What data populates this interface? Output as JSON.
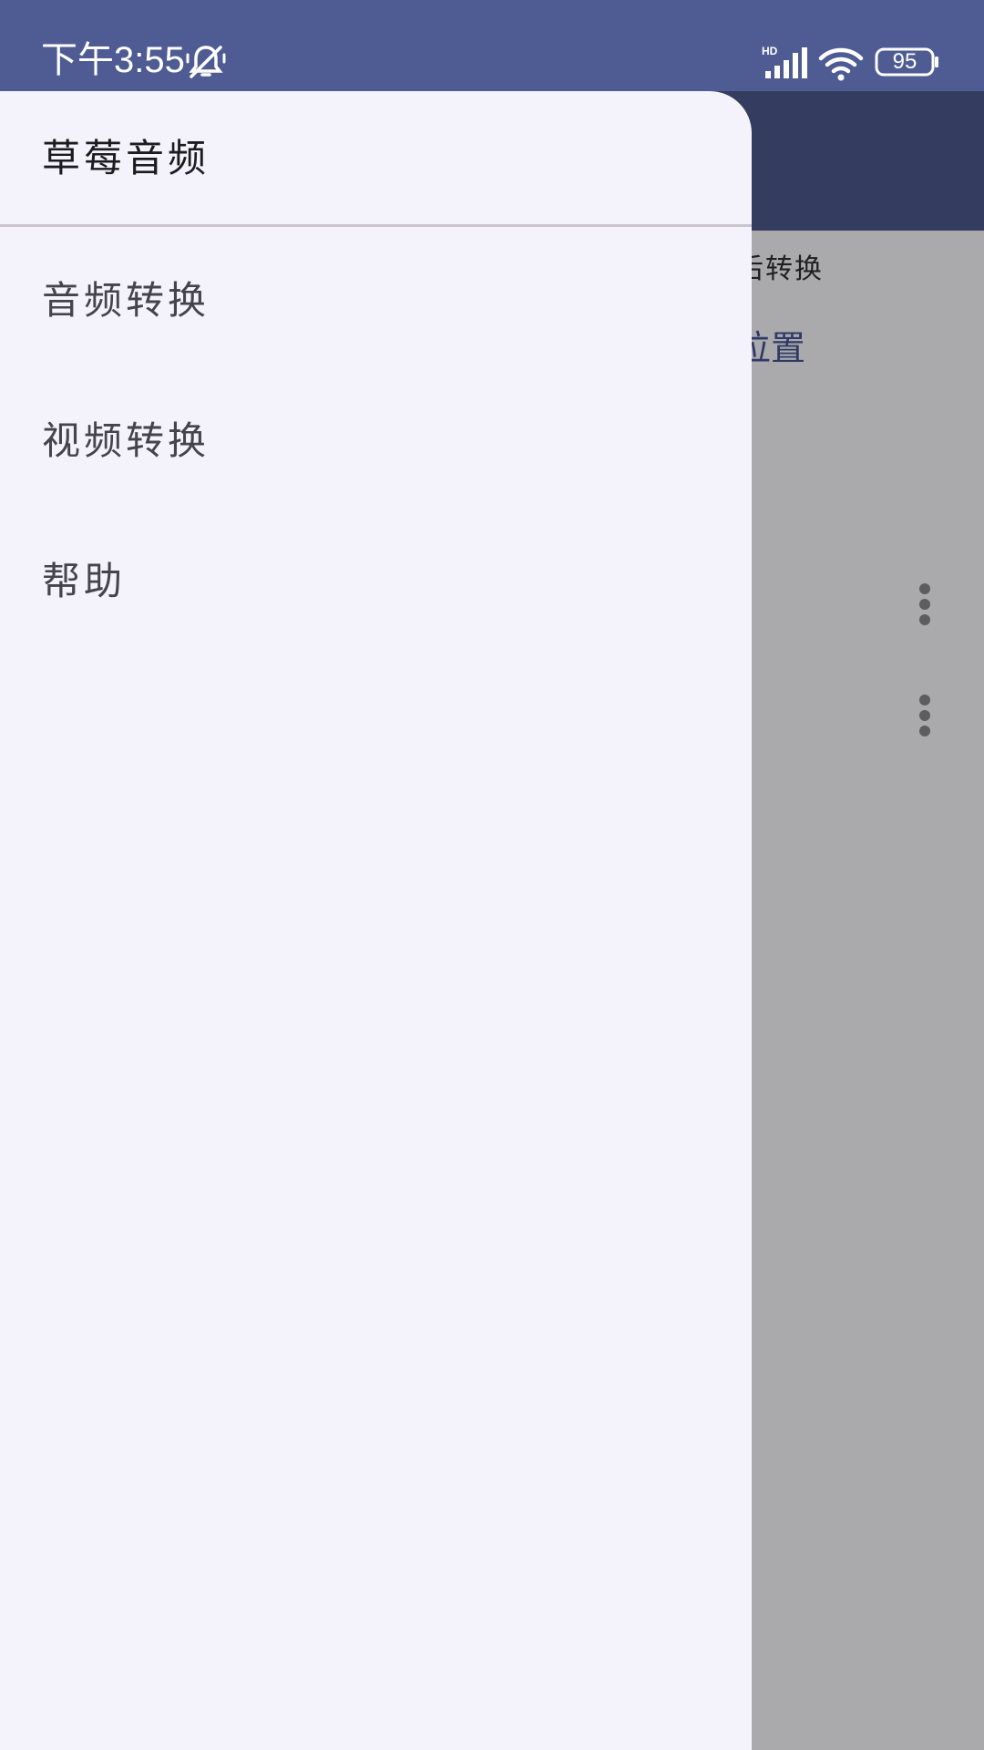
{
  "status_bar": {
    "time": "下午3:55",
    "network_badge": "HD",
    "battery_level": "95",
    "icons": [
      "mute-icon",
      "signal-icon",
      "wifi-icon",
      "battery-icon"
    ]
  },
  "background_app": {
    "tab_label_partial": "后转换",
    "link_partial": "位置",
    "more_icons": [
      "more-vert-icon",
      "more-vert-icon"
    ]
  },
  "drawer": {
    "title": "草莓音频",
    "items": [
      {
        "label": "音频转换"
      },
      {
        "label": "视频转换"
      },
      {
        "label": "帮助"
      }
    ]
  },
  "colors": {
    "status_bar": "#4f5c93",
    "app_bar": "#343c60",
    "drawer_bg": "#f4f2fa",
    "scrim": "#aaa9ac"
  }
}
